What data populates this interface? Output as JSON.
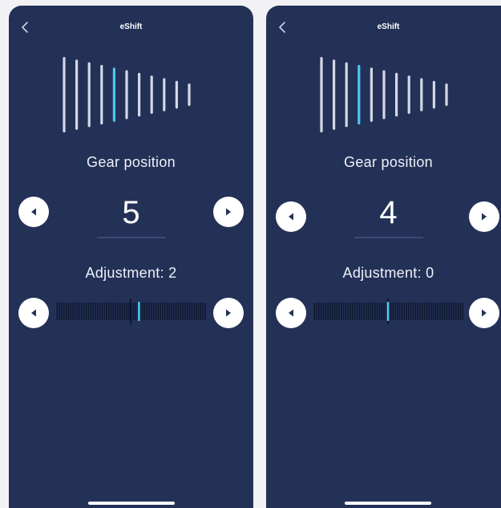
{
  "screens": [
    {
      "title": "eShift",
      "gear_label": "Gear position",
      "gear_value": "5",
      "adjustment_text": "Adjustment: 2",
      "gear_count": 11,
      "selected_gear": 5,
      "adjustment": 2,
      "adjustment_range": [
        -10,
        10
      ]
    },
    {
      "title": "eShift",
      "gear_label": "Gear position",
      "gear_value": "4",
      "adjustment_text": "Adjustment: 0",
      "gear_count": 11,
      "selected_gear": 4,
      "adjustment": 0,
      "adjustment_range": [
        -10,
        10
      ]
    }
  ],
  "colors": {
    "background": "#243157",
    "accent": "#4fc8f0",
    "gear_bar": "#d4d8e6",
    "slider_tick": "#0f1a33",
    "button": "#ffffff"
  },
  "icons": {
    "back": "chevron-left-icon",
    "prev": "triangle-left-icon",
    "next": "triangle-right-icon"
  }
}
